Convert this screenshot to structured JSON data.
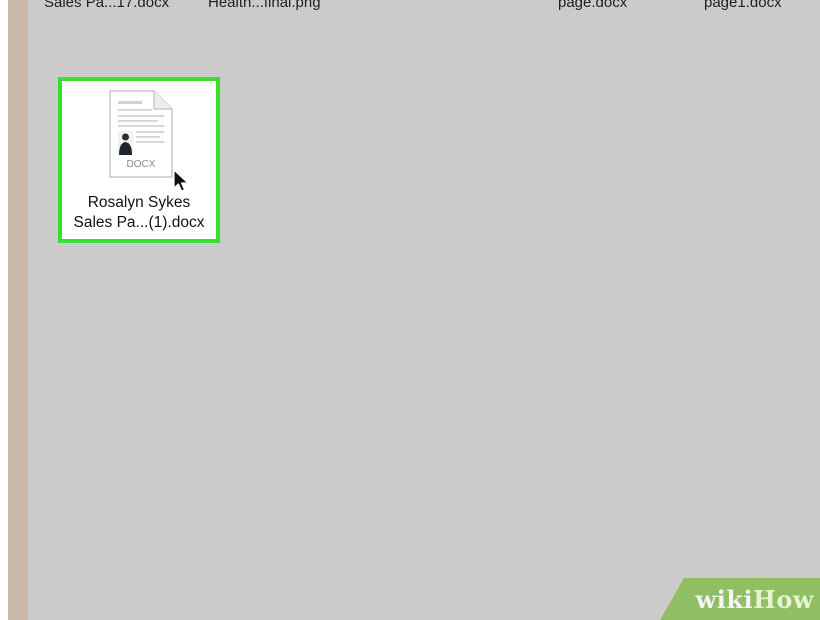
{
  "top_row_labels": [
    "Sales Pa...17.docx",
    "Health...final.png",
    "page.docx",
    "page1.docx"
  ],
  "selected_file": {
    "name_line1": "Rosalyn Sykes",
    "name_line2": "Sales Pa...(1).docx",
    "icon_label": "DOCX"
  },
  "watermark": {
    "part1": "wiki",
    "part2": "How"
  },
  "colors": {
    "desktop_bg": "#cbcbcb",
    "selection_border": "#35e02f",
    "watermark_green": "#8fbf62"
  }
}
